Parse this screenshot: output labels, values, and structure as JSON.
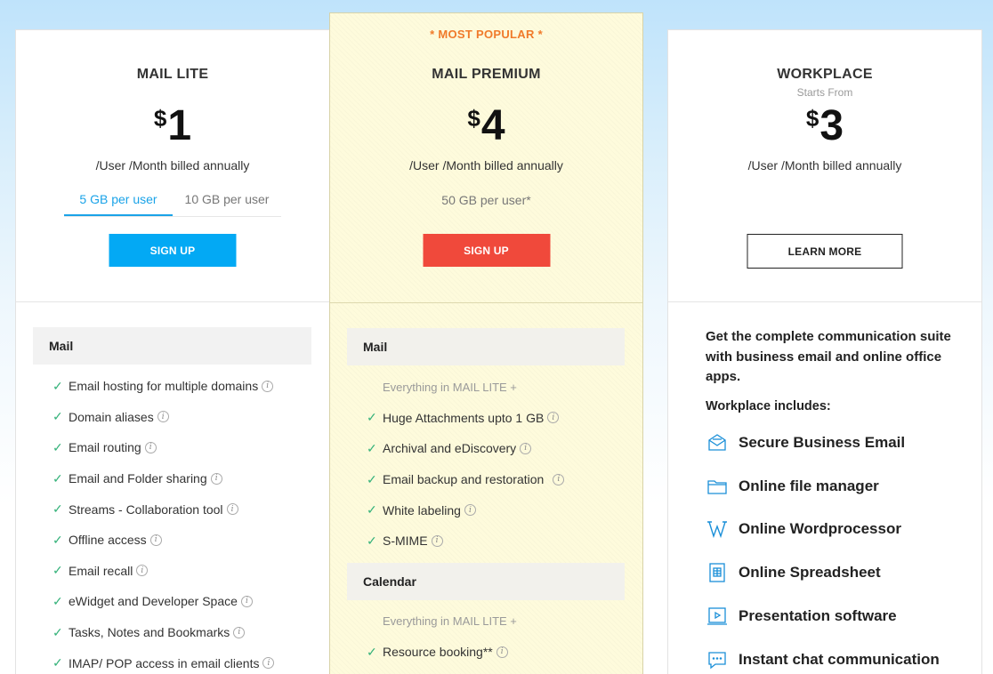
{
  "plans": {
    "lite": {
      "name": "MAIL LITE",
      "currency": "$",
      "amount": "1",
      "billing": "/User /Month billed annually",
      "storage_tabs": [
        "5 GB per user",
        "10 GB per user"
      ],
      "selected_storage": "5 GB per user",
      "cta": "SIGN UP",
      "section": "Mail",
      "features": [
        "Email hosting for multiple domains",
        "Domain aliases",
        "Email routing",
        "Email and Folder sharing",
        "Streams - Collaboration tool",
        "Offline access",
        "Email recall",
        "eWidget and Developer Space",
        "Tasks, Notes and Bookmarks",
        "IMAP/ POP access in email clients"
      ]
    },
    "premium": {
      "badge": "* MOST POPULAR *",
      "name": "MAIL PREMIUM",
      "currency": "$",
      "amount": "4",
      "billing": "/User /Month billed annually",
      "storage": "50 GB per user*",
      "cta": "SIGN UP",
      "sections": [
        {
          "title": "Mail",
          "note": "Everything in MAIL LITE +",
          "features": [
            "Huge Attachments upto 1 GB",
            "Archival and eDiscovery",
            "Email backup and restoration",
            "White labeling",
            "S-MIME"
          ]
        },
        {
          "title": "Calendar",
          "note": "Everything in MAIL LITE +",
          "features": [
            "Resource booking**"
          ]
        }
      ]
    },
    "workplace": {
      "name": "WORKPLACE",
      "starts_from": "Starts From",
      "currency": "$",
      "amount": "3",
      "billing": "/User /Month billed annually",
      "cta": "LEARN MORE",
      "description": "Get the complete communication suite with business email and online office apps.",
      "includes_label": "Workplace includes:",
      "apps": [
        {
          "label": "Secure Business Email",
          "icon": "envelope-icon"
        },
        {
          "label": "Online file manager",
          "icon": "folder-icon"
        },
        {
          "label": "Online Wordprocessor",
          "icon": "writer-icon"
        },
        {
          "label": "Online Spreadsheet",
          "icon": "spreadsheet-icon"
        },
        {
          "label": "Presentation software",
          "icon": "presentation-icon"
        },
        {
          "label": "Instant chat communication",
          "icon": "chat-icon"
        }
      ]
    }
  },
  "colors": {
    "accent_blue": "#03a9f4",
    "signup_red": "#f0493b",
    "popular_orange": "#f07a2a",
    "check_green": "#35b27a",
    "premium_bg": "#fefbdc",
    "icon_blue": "#1a8fd8"
  }
}
